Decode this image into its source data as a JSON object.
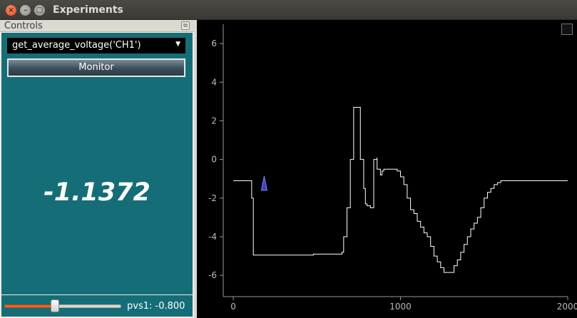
{
  "window": {
    "title": "Experiments"
  },
  "controls": {
    "dock_title": "Controls",
    "function_select": "get_average_voltage('CH1')",
    "monitor_label": "Monitor",
    "readout": "-1.1372",
    "slider_value": -0.8,
    "slider_fraction": 0.43,
    "slider_label": "pvs1: -0.800"
  },
  "colors": {
    "panel": "#156e77",
    "slider_fill": "#e9642c",
    "trace": "#ffffff",
    "marker": "#4040c0"
  },
  "chart_data": {
    "type": "line",
    "title": "",
    "xlabel": "",
    "ylabel": "",
    "xlim": [
      -60,
      2000
    ],
    "ylim": [
      -7.1,
      7.0
    ],
    "xticks": [
      "0",
      "1000",
      "2000"
    ],
    "xtick_values": [
      0,
      1000,
      2000
    ],
    "yticks": [
      "6",
      "4",
      "2",
      "0",
      "-2",
      "-4",
      "-6"
    ],
    "ytick_values": [
      6,
      4,
      2,
      0,
      -2,
      -4,
      -6
    ],
    "grid": false,
    "marker": {
      "x": 185,
      "y": -1.6
    },
    "series": [
      {
        "x": [
          0,
          110,
          110,
          120,
          120,
          480,
          480,
          640,
          650,
          660,
          680,
          700,
          720,
          730,
          740,
          760,
          780,
          790,
          800,
          810,
          820,
          840,
          860,
          860,
          870,
          880,
          890,
          900,
          920,
          940,
          960,
          980,
          1000,
          1020,
          1040,
          1060,
          1080,
          1100,
          1120,
          1140,
          1160,
          1180,
          1200,
          1220,
          1240,
          1260,
          1280,
          1300,
          1320,
          1340,
          1360,
          1380,
          1400,
          1420,
          1440,
          1460,
          1480,
          1500,
          1520,
          1540,
          1560,
          1580,
          1600,
          1620,
          1640,
          1660,
          1680,
          1700,
          1740,
          1760,
          1800,
          1900,
          2000
        ],
        "y": [
          -1.1,
          -1.1,
          -2.0,
          -3.5,
          -4.95,
          -4.95,
          -4.9,
          -4.9,
          -4.8,
          -4.0,
          -2.5,
          0.0,
          2.7,
          2.7,
          2.7,
          0.0,
          -1.5,
          -2.3,
          -2.4,
          -2.4,
          -2.5,
          0.0,
          0.1,
          -0.5,
          -0.5,
          -0.8,
          -0.6,
          -0.5,
          -0.5,
          -0.5,
          -0.5,
          -0.6,
          -0.9,
          -1.3,
          -2.0,
          -2.6,
          -2.8,
          -3.2,
          -3.5,
          -3.8,
          -4.0,
          -4.5,
          -5.0,
          -5.3,
          -5.6,
          -5.85,
          -5.85,
          -5.85,
          -5.5,
          -5.2,
          -4.8,
          -4.4,
          -4.0,
          -3.6,
          -3.3,
          -3.0,
          -2.5,
          -2.0,
          -1.7,
          -1.5,
          -1.3,
          -1.2,
          -1.1,
          -1.1,
          -1.1,
          -1.1,
          -1.1,
          -1.1,
          -1.1,
          -1.1,
          -1.1,
          -1.1,
          -1.1
        ]
      }
    ]
  }
}
